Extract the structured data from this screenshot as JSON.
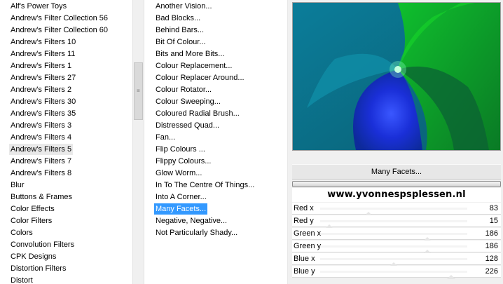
{
  "left_list": {
    "items": [
      "Alf's Power Toys",
      "Andrew's Filter Collection 56",
      "Andrew's Filter Collection 60",
      "Andrew's Filters 10",
      "Andrew's Filters 11",
      "Andrew's Filters 1",
      "Andrew's Filters 27",
      "Andrew's Filters 2",
      "Andrew's Filters 30",
      "Andrew's Filters 35",
      "Andrew's Filters 3",
      "Andrew's Filters 4",
      "Andrew's Filters 5",
      "Andrew's Filters 7",
      "Andrew's Filters 8",
      "Blur",
      "Buttons & Frames",
      "Color Effects",
      "Color Filters",
      "Colors",
      "Convolution Filters",
      "CPK Designs",
      "Distortion Filters",
      "Distort"
    ],
    "hover_index": 12
  },
  "mid_list": {
    "items": [
      "Another Vision...",
      "Bad Blocks...",
      "Behind Bars...",
      "Bit Of Colour...",
      "Bits and More Bits...",
      "Colour Replacement...",
      "Colour Replacer Around...",
      "Colour Rotator...",
      "Colour Sweeping...",
      "Coloured Radial Brush...",
      "Distressed Quad...",
      "Fan...",
      "Flip Colours ...",
      "Flippy Colours...",
      "Glow Worm...",
      "In To The Centre Of Things...",
      "Into A Corner...",
      "Many Facets...",
      "Negative, Negative...",
      "Not Particularly Shady..."
    ],
    "selected_index": 17
  },
  "filter_name": "Many Facets...",
  "watermark": "www.yvonnespsplessen.nl",
  "params": [
    {
      "label": "Red x",
      "value": "83",
      "level": 0.33
    },
    {
      "label": "Red y",
      "value": "15",
      "level": 0.06
    },
    {
      "label": "Green x",
      "value": "186",
      "level": 0.73
    },
    {
      "label": "Green y",
      "value": "186",
      "level": 0.73
    },
    {
      "label": "Blue x",
      "value": "128",
      "level": 0.5
    },
    {
      "label": "Blue y",
      "value": "226",
      "level": 0.89
    }
  ],
  "colors": {
    "selection": "#3399ff",
    "preview_teal": "#0c6f86",
    "preview_green": "#11a82f",
    "preview_blue": "#1a2fd8"
  },
  "icons": {
    "scrollbar_grip": "three-horizontal-lines"
  }
}
